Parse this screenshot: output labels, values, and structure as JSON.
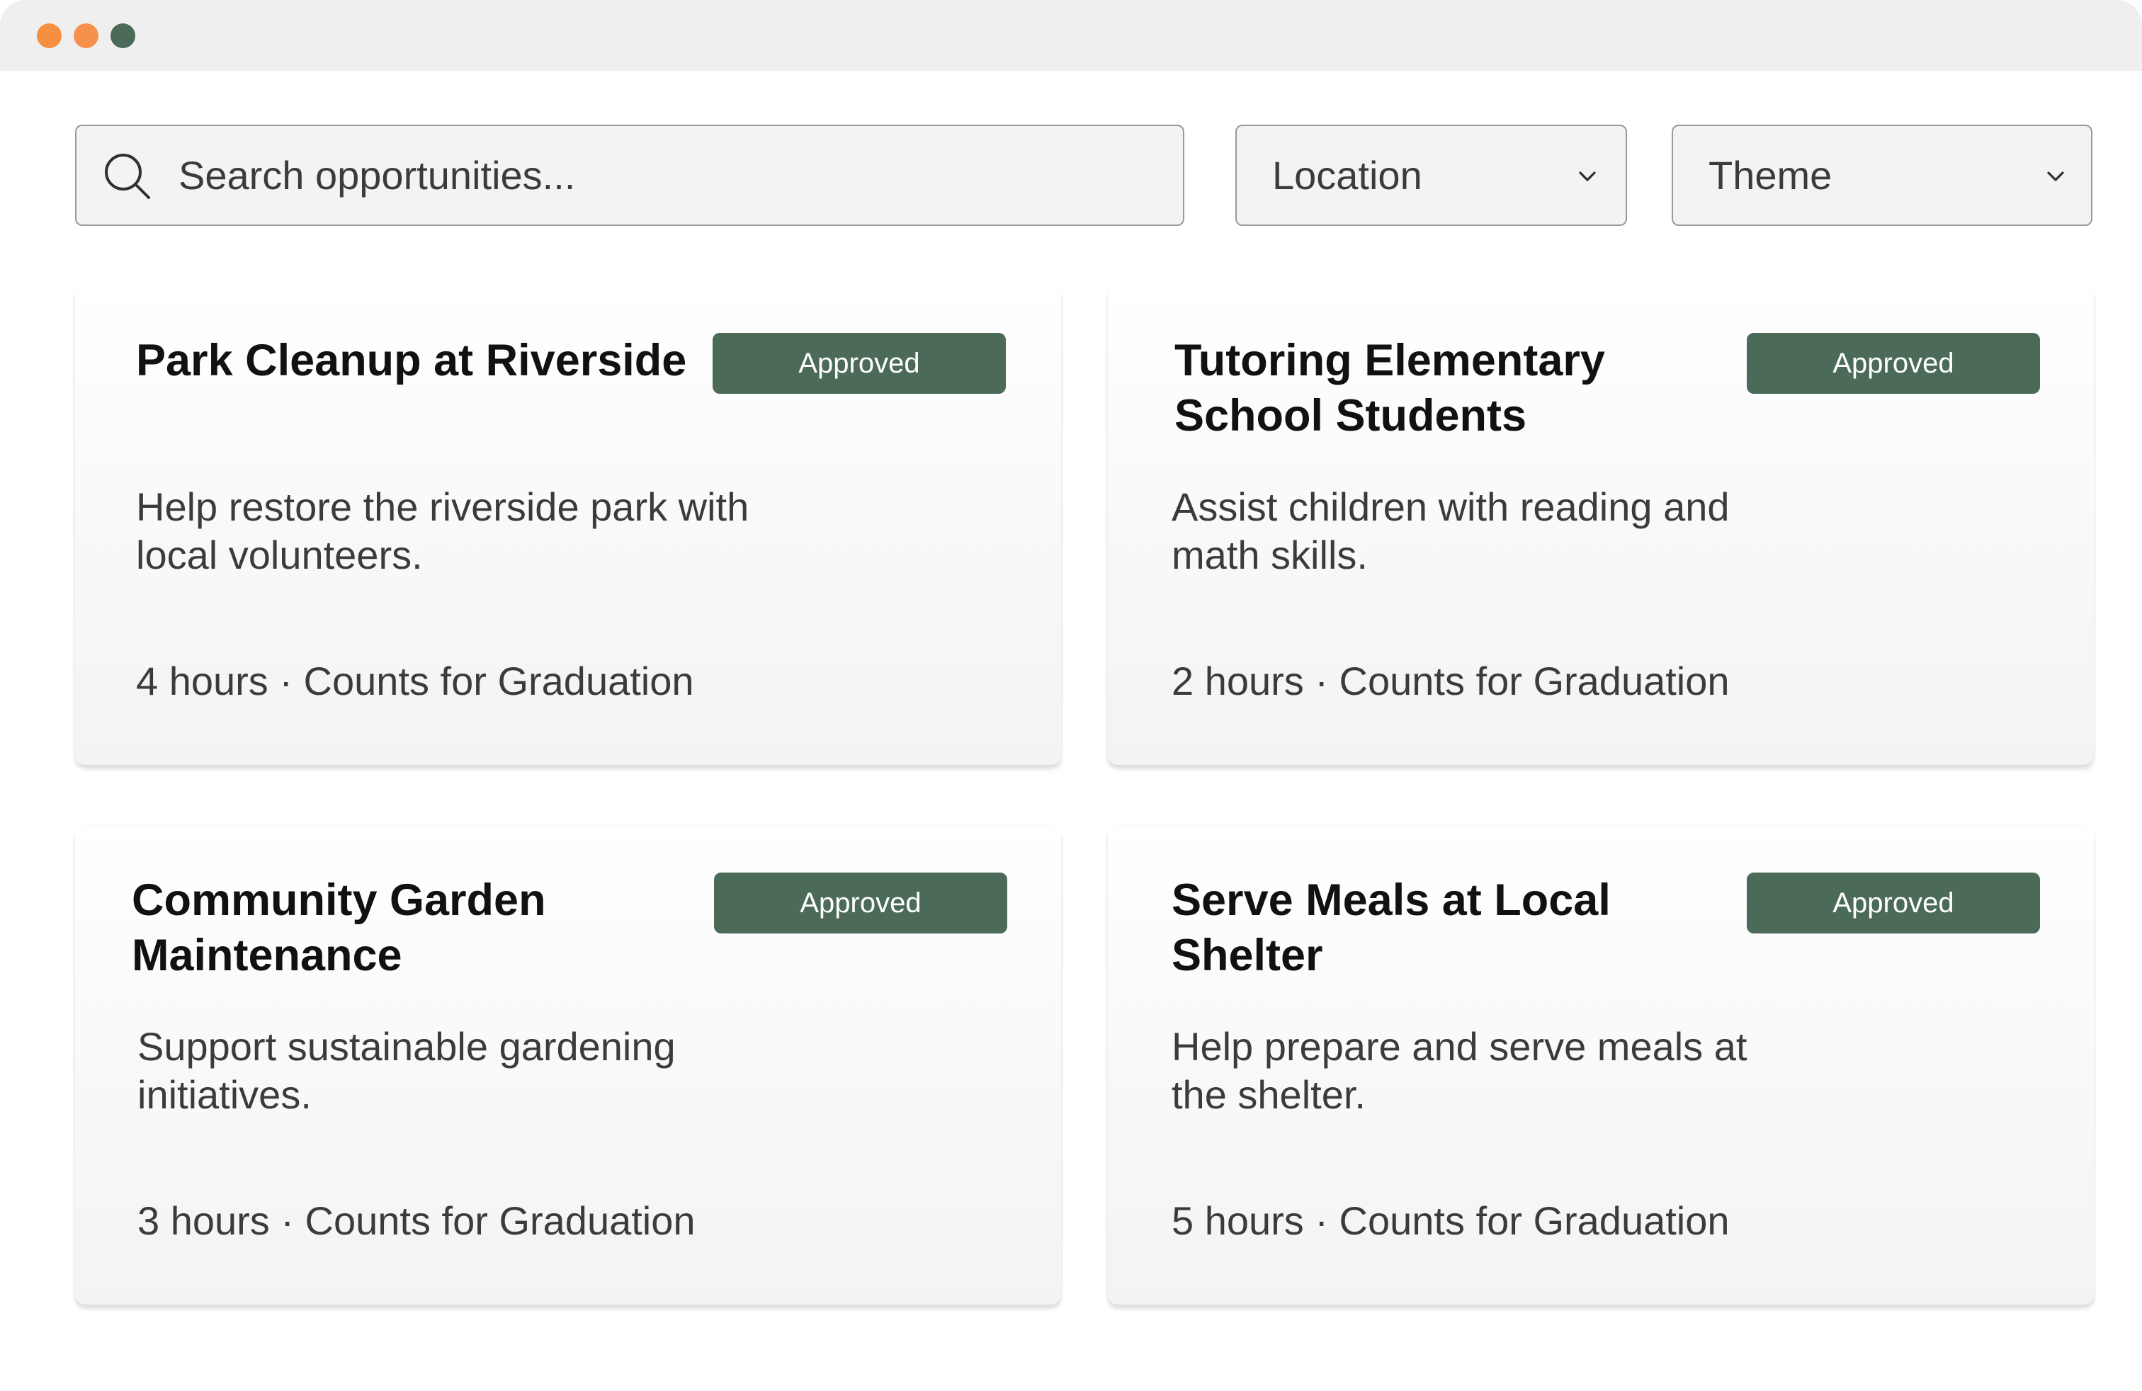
{
  "colors": {
    "traffic_light_1": "#f69040",
    "traffic_light_2": "#f6904a",
    "traffic_light_3": "#4b6b58",
    "badge_background": "#4b6b58",
    "badge_text": "#ffffff"
  },
  "search": {
    "placeholder": "Search opportunities...",
    "icon": "search-icon"
  },
  "filters": {
    "location": {
      "label": "Location",
      "icon": "chevron-down-icon"
    },
    "theme": {
      "label": "Theme",
      "icon": "chevron-down-icon"
    }
  },
  "opportunities": [
    {
      "title": "Park Cleanup at Riverside",
      "status": "Approved",
      "description": "Help restore the riverside park with local volunteers.",
      "meta": "4 hours · Counts for Graduation"
    },
    {
      "title": "Tutoring Elementary School Students",
      "status": "Approved",
      "description": "Assist children with reading and math skills.",
      "meta": "2 hours · Counts for Graduation"
    },
    {
      "title": "Community Garden Maintenance",
      "status": "Approved",
      "description": "Support sustainable gardening initiatives.",
      "meta": "3 hours · Counts for Graduation"
    },
    {
      "title": "Serve Meals at Local Shelter",
      "status": "Approved",
      "description": "Help prepare and serve meals at the shelter.",
      "meta": "5 hours · Counts for Graduation"
    }
  ]
}
